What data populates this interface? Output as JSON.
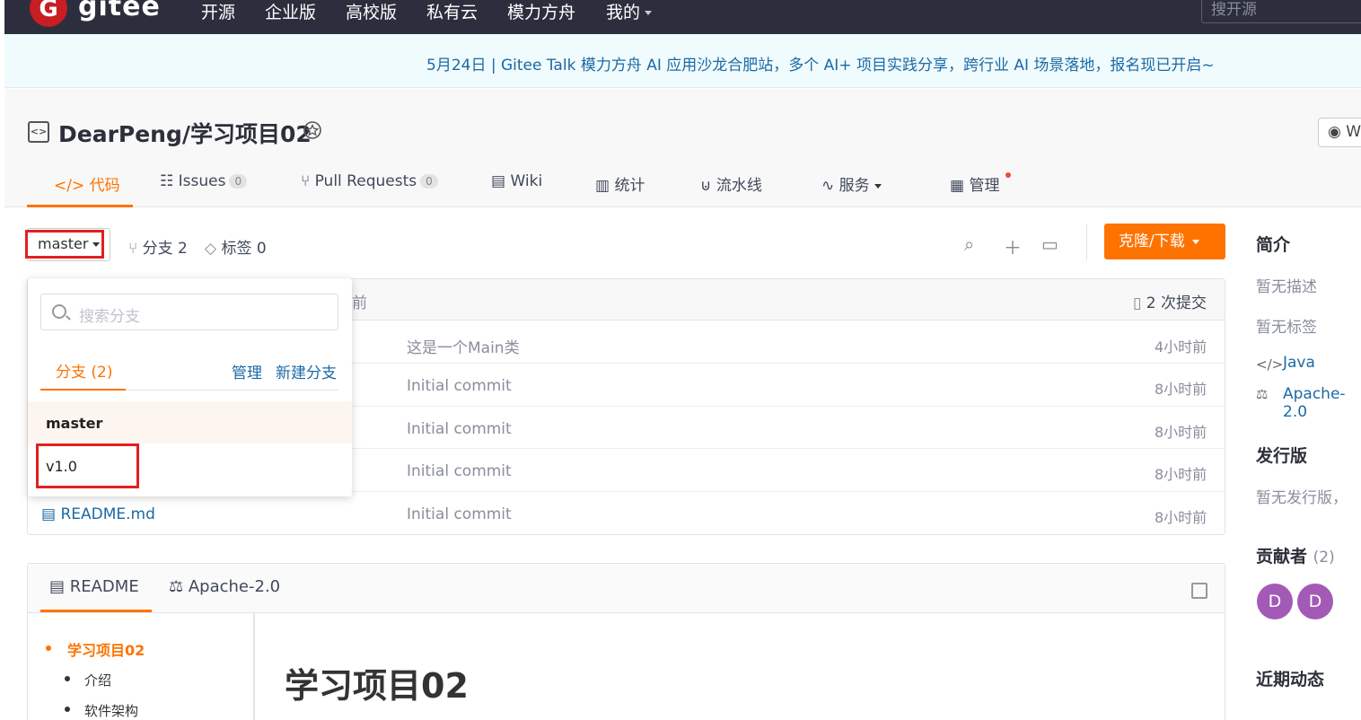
{
  "nav": {
    "logo_letter": "G",
    "logo_text": "gitee",
    "items": [
      "开源",
      "企业版",
      "高校版",
      "私有云",
      "模力方舟",
      "我的"
    ],
    "search_placeholder": "搜开源"
  },
  "banner": {
    "text": "5月24日 | Gitee Talk 模力方舟 AI 应用沙龙合肥站，多个 AI+ 项目实践分享，跨行业 AI 场景落地，报名现已开启~"
  },
  "project": {
    "icon_text": "<>",
    "title": "DearPeng/学习项目02",
    "watch_label": "W"
  },
  "tabs": {
    "code": "代码",
    "issues": "Issues",
    "issues_count": "0",
    "pulls": "Pull Requests",
    "pulls_count": "0",
    "wiki": "Wiki",
    "stats": "统计",
    "pipeline": "流水线",
    "services": "服务",
    "manage": "管理"
  },
  "toolbar": {
    "branch": "master",
    "branches": "分支 2",
    "tags": "标签 0",
    "clone": "克隆/下载"
  },
  "files": {
    "header_time_partial": "前",
    "commits": "2 次提交",
    "rows": [
      {
        "message": "这是一个Main类",
        "time": "4小时前"
      },
      {
        "message": "Initial commit",
        "time": "8小时前"
      },
      {
        "message": "Initial commit",
        "time": "8小时前"
      },
      {
        "message": "Initial commit",
        "time": "8小时前"
      },
      {
        "name": "README.md",
        "message": "Initial commit",
        "time": "8小时前"
      }
    ]
  },
  "dropdown": {
    "search_placeholder": "搜索分支",
    "tab": "分支 (2)",
    "manage": "管理",
    "new_branch": "新建分支",
    "branches": [
      "master",
      "v1.0"
    ]
  },
  "readme": {
    "tab_readme": "README",
    "tab_license": "Apache-2.0",
    "toc": [
      "学习项目02",
      "介绍",
      "软件架构"
    ],
    "heading": "学习项目02"
  },
  "sidebar": {
    "intro_title": "简介",
    "no_desc": "暂无描述",
    "no_tags": "暂无标签",
    "lang": "Java",
    "license": "Apache-2.0",
    "release_title": "发行版",
    "no_release": "暂无发行版，",
    "contrib_title": "贡献者",
    "contrib_count": "(2)",
    "avatars": [
      "D",
      "D"
    ],
    "activity_title": "近期动态"
  },
  "colors": {
    "accent": "#fe7300",
    "link": "#1b6aa5",
    "nav_bg": "#2c2e3e",
    "highlight": "#e02020"
  }
}
